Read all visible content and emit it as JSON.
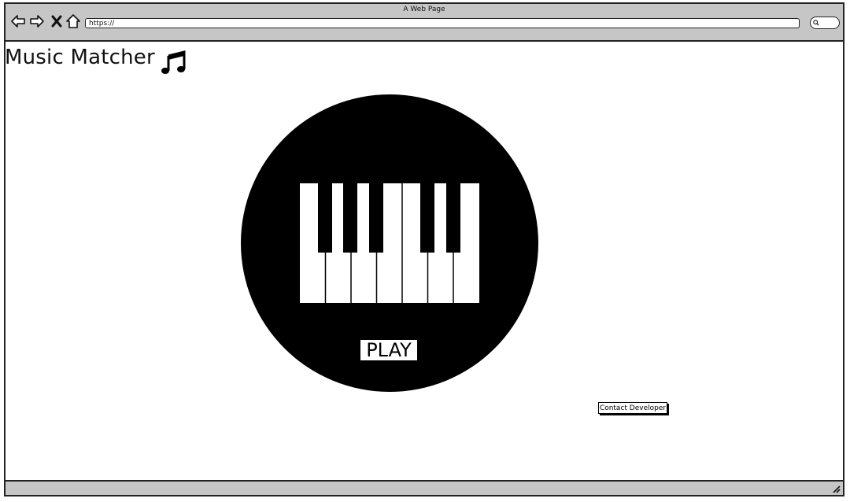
{
  "window": {
    "title": "A Web Page",
    "url": "https://"
  },
  "toolbar": {
    "icons": [
      "back-arrow-icon",
      "forward-arrow-icon",
      "close-x-icon",
      "home-icon",
      "search-icon"
    ]
  },
  "page": {
    "title": "Music Matcher",
    "title_icon": "music-note-icon",
    "hero_graphic": "piano-keys-icon",
    "play_label": "PLAY",
    "contact_label": "Contact Developer"
  },
  "colors": {
    "chrome": "#c6c6c6",
    "hero": "#000000",
    "background": "#ffffff"
  }
}
